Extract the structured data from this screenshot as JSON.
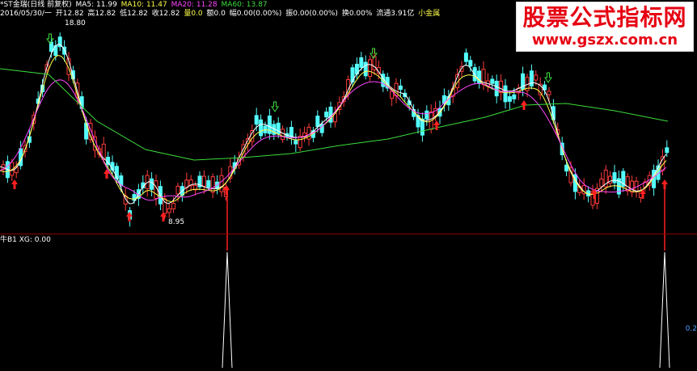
{
  "header": {
    "symbol": "*ST金瑞(日线 前复权)",
    "ma5_label": "MA5: 11.99",
    "ma10_label": "MA10: 11.47",
    "ma20_label": "MA20: 11.28",
    "ma60_label": "MA60: 13.87"
  },
  "quote": {
    "date": "2016/05/30/一",
    "open": "开12.82",
    "high": "高12.82",
    "low": "低12.82",
    "close": "收12.82",
    "vol": "量0.0",
    "amount": "额0.0",
    "change": "幅0.00(0.00%)",
    "amp": "振0.00(0.00%)",
    "turnover": "换0.00%",
    "float_cap": "流通3.91亿",
    "name": "小金属"
  },
  "chart": {
    "high_marker": "18.80",
    "low_marker": "8.95"
  },
  "indicator": {
    "label": "牛B1 XG: 0.00",
    "axis_value": "0.2"
  },
  "watermark": {
    "title": "股票公式指标网",
    "url": "www.gszx.com.cn"
  },
  "colors": {
    "up": "#ff3b3b",
    "down": "#54ffff",
    "ma5": "#ffffff",
    "ma10": "#ffff4a",
    "ma20": "#ff46ff",
    "ma60": "#3cdc3c",
    "signal": "#ff2020",
    "buy_arrow": "#ff2020",
    "sell_arrow": "#3cdc3c"
  }
}
